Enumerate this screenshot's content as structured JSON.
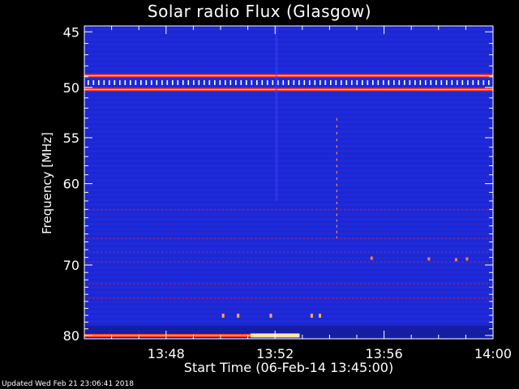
{
  "chart_data": {
    "type": "heatmap",
    "title": "Solar radio Flux (Glasgow)",
    "xlabel": "Start Time (06-Feb-14 13:45:00)",
    "ylabel": "Frequency [MHz]",
    "x_ticks": [
      "13:48",
      "13:52",
      "13:56",
      "14:00"
    ],
    "x_tick_minutes": [
      48,
      52,
      56,
      60
    ],
    "x_range_minutes": [
      45,
      60
    ],
    "y_ticks": [
      45,
      50,
      55,
      60,
      70,
      80
    ],
    "y_range_mhz": [
      44.5,
      80.5
    ],
    "y_scale": "log",
    "colormap": [
      "#000010",
      "#0a0a8c",
      "#1e28e6",
      "#ff2020",
      "#ffc864",
      "#ffffff"
    ],
    "background_level": "medium (blue)",
    "interference_bands_mhz": [
      {
        "freq": 48.9,
        "level": "high"
      },
      {
        "freq": 50.2,
        "level": "high"
      },
      {
        "freq": 80.0,
        "level": "high",
        "x_end_minutes": 52.9
      }
    ],
    "grid": false
  },
  "footer": {
    "updated": "Updated Wed Feb 21 23:06:41 2018"
  }
}
